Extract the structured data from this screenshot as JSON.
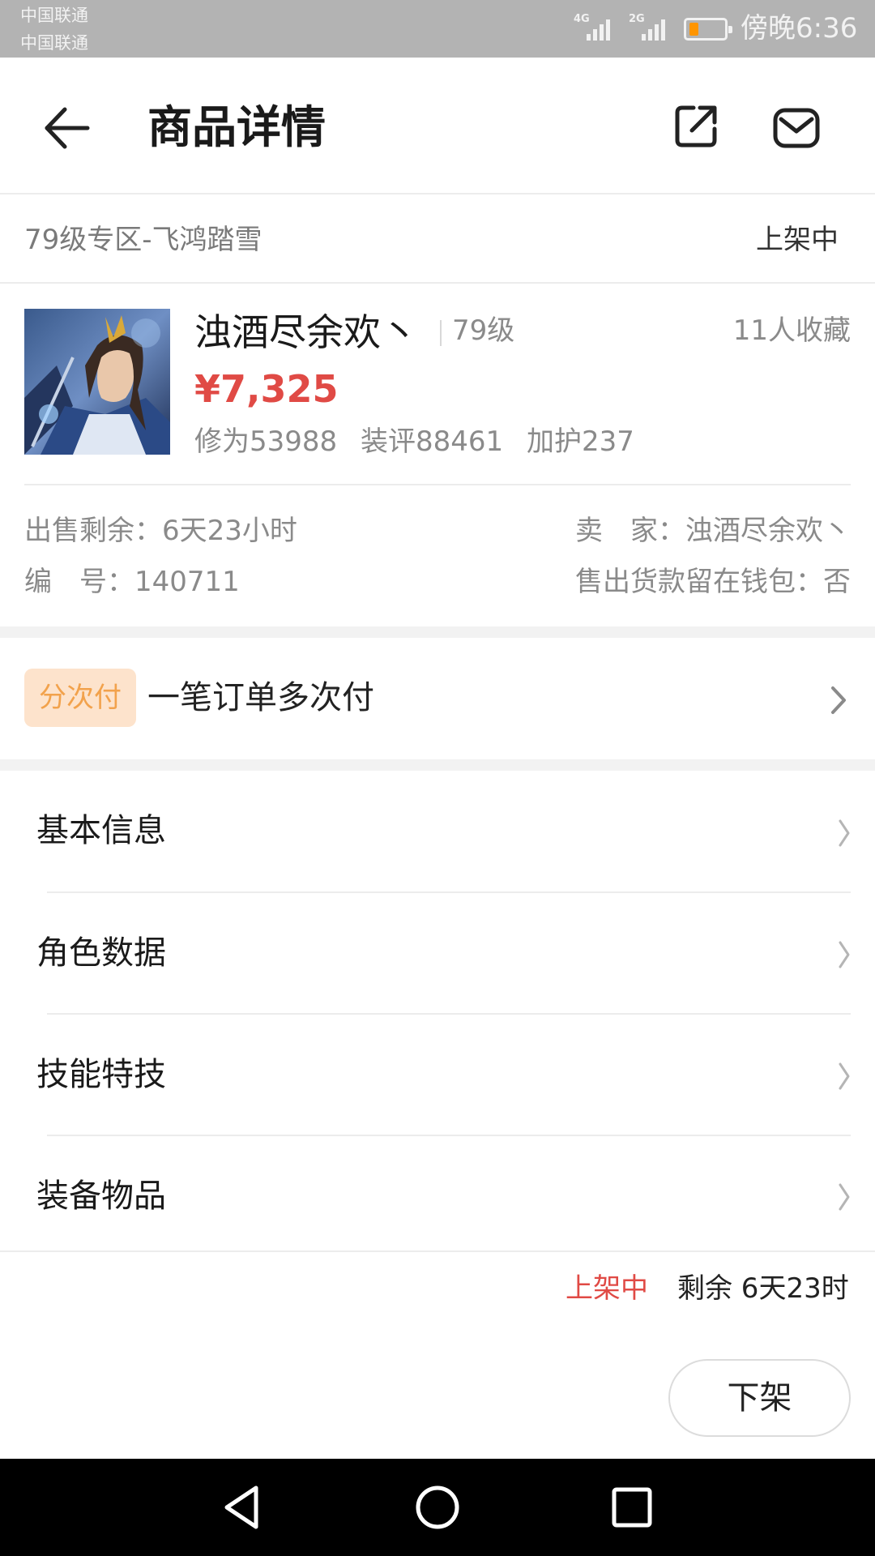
{
  "status_bar": {
    "carrier_1": "中国联通",
    "carrier_2": "中国联通",
    "signal_1": "4G",
    "signal_2": "2G",
    "battery_level": 0.2,
    "battery_color": "#ff9500",
    "time": "傍晚6:36"
  },
  "header": {
    "title": "商品详情",
    "back_icon": "arrow-left-icon",
    "share_icon": "share-external-icon",
    "message_icon": "envelope-icon"
  },
  "zone": {
    "name": "79级专区-飞鸿踏雪",
    "status": "上架中"
  },
  "product": {
    "name": "浊酒尽余欢丶",
    "level": "79级",
    "favorites": "11人收藏",
    "price": "¥7,325",
    "stats": [
      "修为53988",
      "装评88461",
      "加护237"
    ]
  },
  "meta": {
    "time_left": "出售剩余：6天23小时",
    "seller": "卖　家：浊酒尽余欢丶",
    "serial": "编　号：140711",
    "keep_in_wallet": "售出货款留在钱包：否"
  },
  "installment": {
    "badge": "分次付",
    "text": "一笔订单多次付"
  },
  "menu": [
    {
      "label": "基本信息"
    },
    {
      "label": "角色数据"
    },
    {
      "label": "技能特技"
    },
    {
      "label": "装备物品"
    }
  ],
  "footer": {
    "status": "上架中",
    "remaining": "剩余 6天23时",
    "delist_button": "下架"
  },
  "colors": {
    "accent_red": "#e04a45",
    "badge_bg": "#fde3cc",
    "badge_text": "#f2a24c",
    "status_bar_bg": "#b3b3b3"
  },
  "nav_icons": [
    "back-triangle-icon",
    "home-circle-icon",
    "recents-square-icon"
  ]
}
